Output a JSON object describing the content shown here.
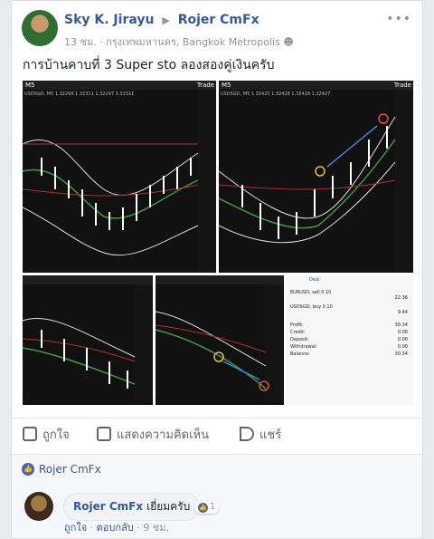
{
  "post": {
    "author": "Sky K. Jirayu",
    "target": "Rojer CmFx",
    "time": "13 ชม.",
    "location": "กรุงเทพมหานคร, Bangkok Metropolis",
    "text": "การบ้านคาบที่ 3 Super sto ลองสองคู่เงินครับ"
  },
  "charts": {
    "c1": {
      "title": "USDSGD, M5 1.32299 1.32311 1.32297 1.32311",
      "tf": "M5",
      "trade": "Trade"
    },
    "c2": {
      "title": "USDSGD, M5 1.32425 1.32428 1.32418 1.32427",
      "tf": "M5",
      "trade": "Trade"
    },
    "balance": {
      "tab": "Deal",
      "rows": [
        {
          "label": "EURUSD, sell 0.10",
          "value": "22.36"
        },
        {
          "label": "USDSGD, buy 0.10",
          "value": "9.44"
        },
        {
          "label": "Profit:",
          "value": "30.34"
        },
        {
          "label": "Credit:",
          "value": "0.00"
        },
        {
          "label": "Deposit:",
          "value": "0.00"
        },
        {
          "label": "Withdrawal:",
          "value": "0.00"
        },
        {
          "label": "Balance:",
          "value": "30.34"
        }
      ]
    }
  },
  "actions": {
    "like": "ถูกใจ",
    "comment": "แสดงความคิดเห็น",
    "share": "แชร์"
  },
  "reactions": {
    "names": "Rojer CmFx"
  },
  "comment": {
    "author": "Rojer CmFx",
    "text": "เยี่ยมครับ",
    "likes": "1",
    "like_link": "ถูกใจ",
    "reply_link": "ตอบกลับ",
    "time": "9 ชม."
  }
}
